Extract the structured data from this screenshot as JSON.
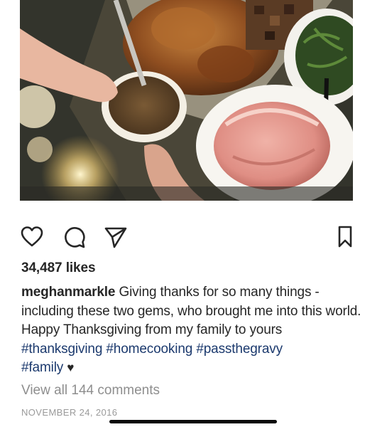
{
  "post": {
    "image_subject": "holiday-dinner-photo",
    "likes": "34,487 likes",
    "caption": {
      "username": "meghanmarkle",
      "text": "Giving thanks for so many things - including these two gems, who brought me into this world. Happy Thanksgiving from my family to yours",
      "hashtags": [
        "#thanksgiving",
        "#homecooking",
        "#passthegravy",
        "#family"
      ],
      "trailing_emoji": "♥"
    },
    "view_comments": "View all 144 comments",
    "date": "NOVEMBER 24, 2016"
  },
  "actions": {
    "like_icon": "heart-outline-icon",
    "comment_icon": "comment-bubble-icon",
    "share_icon": "paper-plane-icon",
    "save_icon": "bookmark-icon"
  },
  "colors": {
    "text": "#262626",
    "hashtag": "#1c3a6e",
    "muted": "#8e8e8e",
    "date": "#9a9a9a"
  }
}
